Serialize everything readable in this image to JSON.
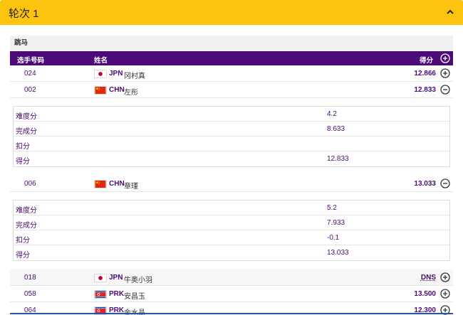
{
  "header": {
    "title": "轮次 1"
  },
  "apparatus": "跳马",
  "table_head": {
    "bib": "选手号码",
    "name": "姓名",
    "score": "得分"
  },
  "labels": {
    "difficulty": "难度分",
    "execution": "完成分",
    "penalty": "扣分",
    "total": "得分"
  },
  "athletes": [
    {
      "bib": "024",
      "noc": "JPN",
      "name": "冈村真",
      "score": "12.866",
      "flag": "jpn"
    },
    {
      "bib": "002",
      "noc": "CHN",
      "name": "左彤",
      "score": "12.833",
      "flag": "chn",
      "detail": {
        "difficulty": "4.2",
        "execution": "8.633",
        "penalty": "",
        "total": "12.833"
      }
    },
    {
      "bib": "006",
      "noc": "CHN",
      "name": "章瑾",
      "score": "13.033",
      "flag": "chn",
      "detail": {
        "difficulty": "5.2",
        "execution": "7.933",
        "penalty": "-0.1",
        "total": "13.033"
      }
    },
    {
      "bib": "018",
      "noc": "JPN",
      "name": "牛奥小羽",
      "score": "DNS",
      "flag": "jpn"
    },
    {
      "bib": "058",
      "noc": "PRK",
      "name": "安昌玉",
      "score": "13.500",
      "flag": "prk"
    },
    {
      "bib": "064",
      "noc": "PRK",
      "name": "金水晶",
      "score": "12.300",
      "flag": "prk"
    }
  ],
  "colors": {
    "accent": "#fcc30f",
    "brand": "#4b0a75",
    "rule": "#1e58a8"
  }
}
